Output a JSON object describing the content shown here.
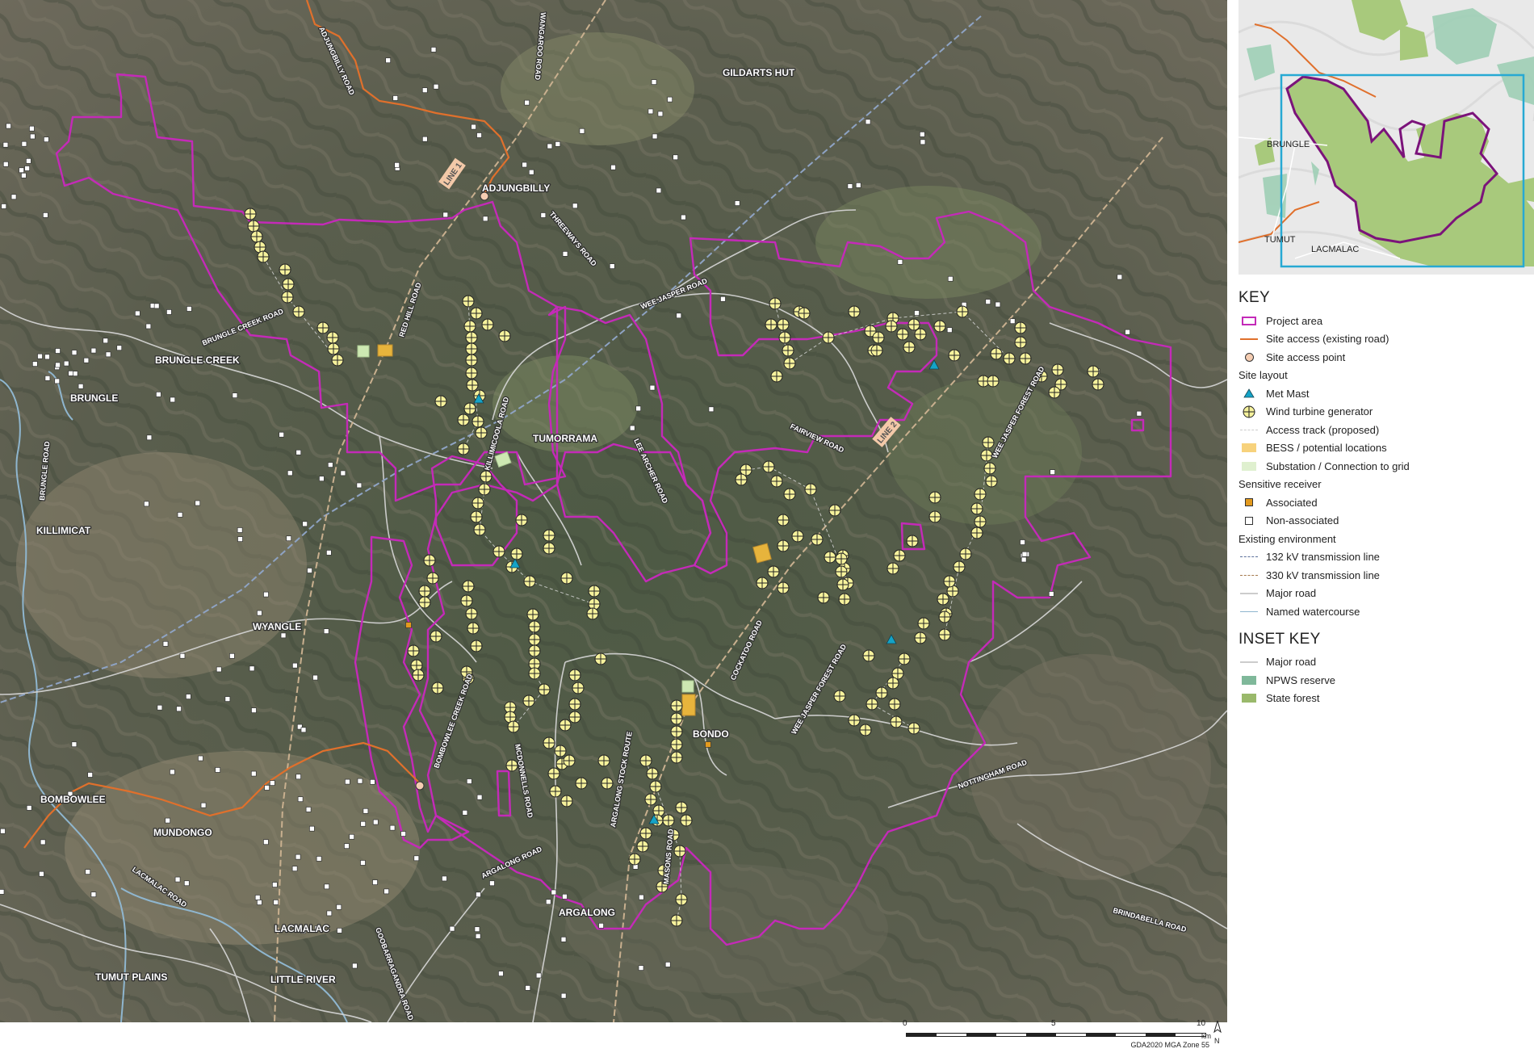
{
  "map": {
    "towns": [
      {
        "name": "GILDARTS HUT"
      },
      {
        "name": "ADJUNGBILLY"
      },
      {
        "name": "BRUNGLE CREEK"
      },
      {
        "name": "BRUNGLE"
      },
      {
        "name": "TUMORRAMA"
      },
      {
        "name": "KILLIMICAT"
      },
      {
        "name": "WYANGLE"
      },
      {
        "name": "BONDO"
      },
      {
        "name": "BOMBOWLEE"
      },
      {
        "name": "MUNDONGO"
      },
      {
        "name": "ARGALONG"
      },
      {
        "name": "LACMALAC"
      },
      {
        "name": "TUMUT PLAINS"
      },
      {
        "name": "LITTLE RIVER"
      }
    ],
    "roads": [
      "ADJUNGBILLY ROAD",
      "WANGAROO ROAD",
      "THREEWAYS ROAD",
      "RED HILL ROAD",
      "BRUNGLE CREEK ROAD",
      "BRUNGLE ROAD",
      "WEE JASPER ROAD",
      "LEE ARCHER ROAD",
      "FAIRVIEW ROAD",
      "WEE JASPER FOREST ROAD",
      "KILLIMICOOLA ROAD",
      "BOMBOWLEE CREEK ROAD",
      "MCDONNELLS ROAD",
      "ARGALONG STOCK ROUTE",
      "COCKATOO ROAD",
      "WEE JASPER FOREST ROAD",
      "NOTTINGHAM ROAD",
      "MASONS ROAD",
      "ARGALONG ROAD",
      "LACMALAC ROAD",
      "GOOBARRAGANDRA ROAD",
      "BRINDABELLA ROAD"
    ],
    "lines": [
      "LINE 1",
      "LINE 2"
    ],
    "colors": {
      "project_area": "#c42ab8",
      "site_access": "#e0702c",
      "turbine": "#f6f29c",
      "met_mast": "#14a3c7",
      "bess": "#e7b43c",
      "substation": "#cde8b2",
      "associated": "#e39a1e"
    }
  },
  "inset": {
    "labels": [
      "BRUNGLE",
      "TUMUT",
      "LACMALAC"
    ]
  },
  "scale": {
    "ticks": [
      "0",
      "5",
      "10"
    ],
    "unit": "km",
    "north": "N",
    "crs": "GDA2020 MGA Zone 55"
  },
  "legend": {
    "title": "KEY",
    "project_area": "Project area",
    "site_access_road": "Site access (existing road)",
    "site_access_point": "Site access point",
    "site_layout": "Site layout",
    "met_mast": "Met Mast",
    "wtg": "Wind turbine generator",
    "access_track": "Access track (proposed)",
    "bess": "BESS / potential locations",
    "substation": "Substation / Connection to grid",
    "sensitive_receiver": "Sensitive receiver",
    "associated": "Associated",
    "non_associated": "Non-associated",
    "existing_env": "Existing environment",
    "tx132": "132 kV transmission line",
    "tx330": "330 kV transmission line",
    "major_road": "Major road",
    "watercourse": "Named watercourse",
    "inset_title": "INSET KEY",
    "inset_major_road": "Major road",
    "npws": "NPWS reserve",
    "state_forest": "State forest"
  }
}
